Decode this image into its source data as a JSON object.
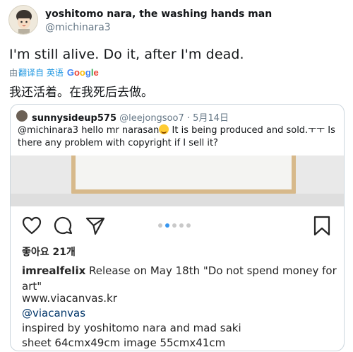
{
  "author": {
    "name": "yoshitomo nara, the washing hands man",
    "handle": "@michinara3"
  },
  "tweet": {
    "text": "I'm still alive. Do it, after I'm dead.",
    "translate_prefix": "由",
    "translate_link": "翻译自 英语",
    "translated_text": "我还活着。在我死后去做。"
  },
  "quote": {
    "name": "sunnysideup575",
    "handle": "@leejongsoo7",
    "date": "· 5月14日",
    "text_before_emoji": "@michinara3  hello mr narasan",
    "text_after_emoji": " It is being produced and sold.ㅜㅜ Is there any problem with copyright if I sell it?",
    "instagram": {
      "likes": "좋아요 21개",
      "carousel_dots": 5,
      "active_dot": 1,
      "caption_user": "imrealfelix",
      "caption_text": " Release on May 18th \"Do not spend money for art\"",
      "link": "www.viacanvas.kr",
      "mention": "@viacanvas",
      "inspired": "inspired by yoshitomo nara and mad saki",
      "size": "sheet 64cmx49cm image 55cmx41cm"
    }
  },
  "google_logo": [
    {
      "ch": "G",
      "color": "#4285f4"
    },
    {
      "ch": "o",
      "color": "#ea4335"
    },
    {
      "ch": "o",
      "color": "#fbbc05"
    },
    {
      "ch": "g",
      "color": "#4285f4"
    },
    {
      "ch": "l",
      "color": "#34a853"
    },
    {
      "ch": "e",
      "color": "#ea4335"
    }
  ],
  "icons": [
    "heart-icon",
    "comment-icon",
    "share-icon",
    "bookmark-icon"
  ]
}
